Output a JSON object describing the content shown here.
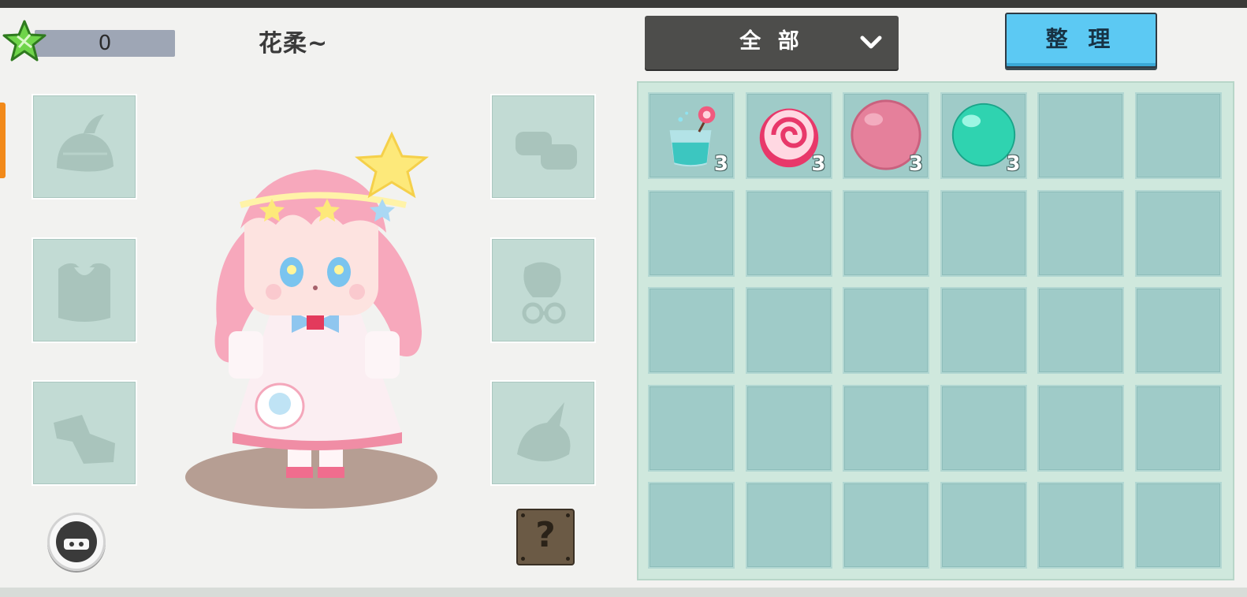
{
  "player": {
    "star_count": "0",
    "character_name": "花柔~"
  },
  "toolbar": {
    "filter_label": "全 部",
    "sort_label": "整 理"
  },
  "equipment_left": [
    {
      "slot": "helmet",
      "icon": "helmet-icon"
    },
    {
      "slot": "armor",
      "icon": "chest-armor-icon"
    },
    {
      "slot": "boots",
      "icon": "boots-icon"
    }
  ],
  "equipment_right": [
    {
      "slot": "gloves",
      "icon": "gloves-icon"
    },
    {
      "slot": "accessory",
      "icon": "glasses-accessory-icon"
    },
    {
      "slot": "mount",
      "icon": "dragon-head-icon"
    }
  ],
  "inventory": {
    "columns": 6,
    "rows": 5,
    "items": [
      {
        "name": "drink-icon",
        "quantity": "3"
      },
      {
        "name": "candy-icon",
        "quantity": "3"
      },
      {
        "name": "pink-ball-icon",
        "quantity": "3"
      },
      {
        "name": "green-orb-icon",
        "quantity": "3"
      }
    ]
  },
  "colors": {
    "accent_blue": "#5cc9f3",
    "panel_green": "#cfe8dd",
    "cell": "#9fcbc8",
    "side_tab": "#f28a1a"
  }
}
